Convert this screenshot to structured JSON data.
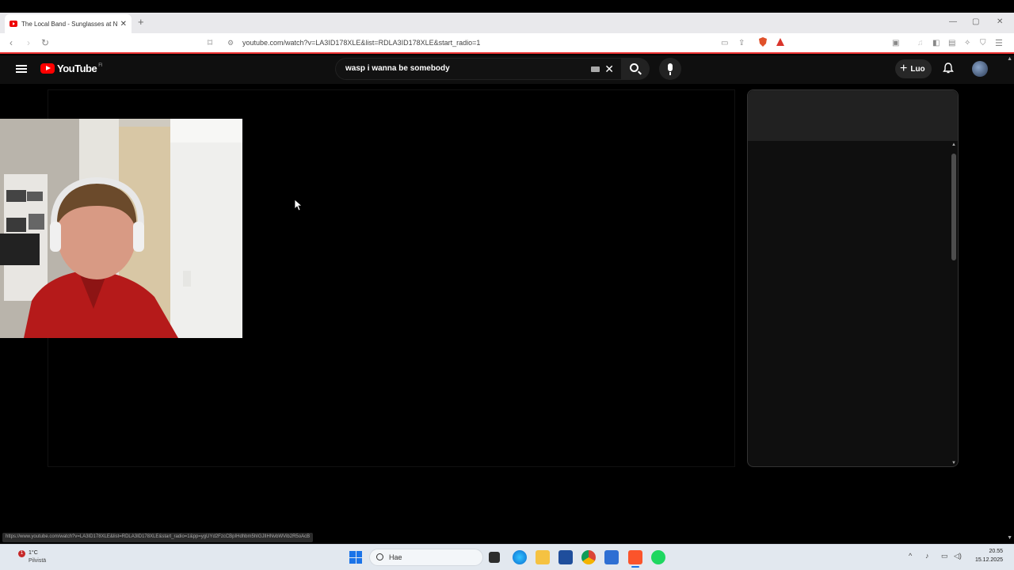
{
  "browser": {
    "tab_title": "The Local Band - Sunglasses at N",
    "tab_close": "✕",
    "new_tab": "+",
    "url": "youtube.com/watch?v=LA3ID178XLE&list=RDLA3ID178XLE&start_radio=1",
    "status_url": "https://www.youtube.com/watch?v=LA3ID178XLE&list=RDLA3ID178XLE&start_radio=1&pp=ygUYd2FzcCBpIHdhbm5hIGJlIHNvbWVib2R5oAcB"
  },
  "youtube": {
    "logo_text": "YouTube",
    "region": "FI",
    "search_value": "wasp i wanna be somebody",
    "create_label": "Luo"
  },
  "taskbar": {
    "weather_temp": "1°C",
    "weather_desc": "Pilvistä",
    "weather_badge": "1",
    "search_label": "Hae",
    "time": "20.55",
    "date": "15.12.2025"
  },
  "colors": {
    "brand_red": "#ff0000",
    "accent_line": "#e33333",
    "bg": "#0f0f0f"
  }
}
